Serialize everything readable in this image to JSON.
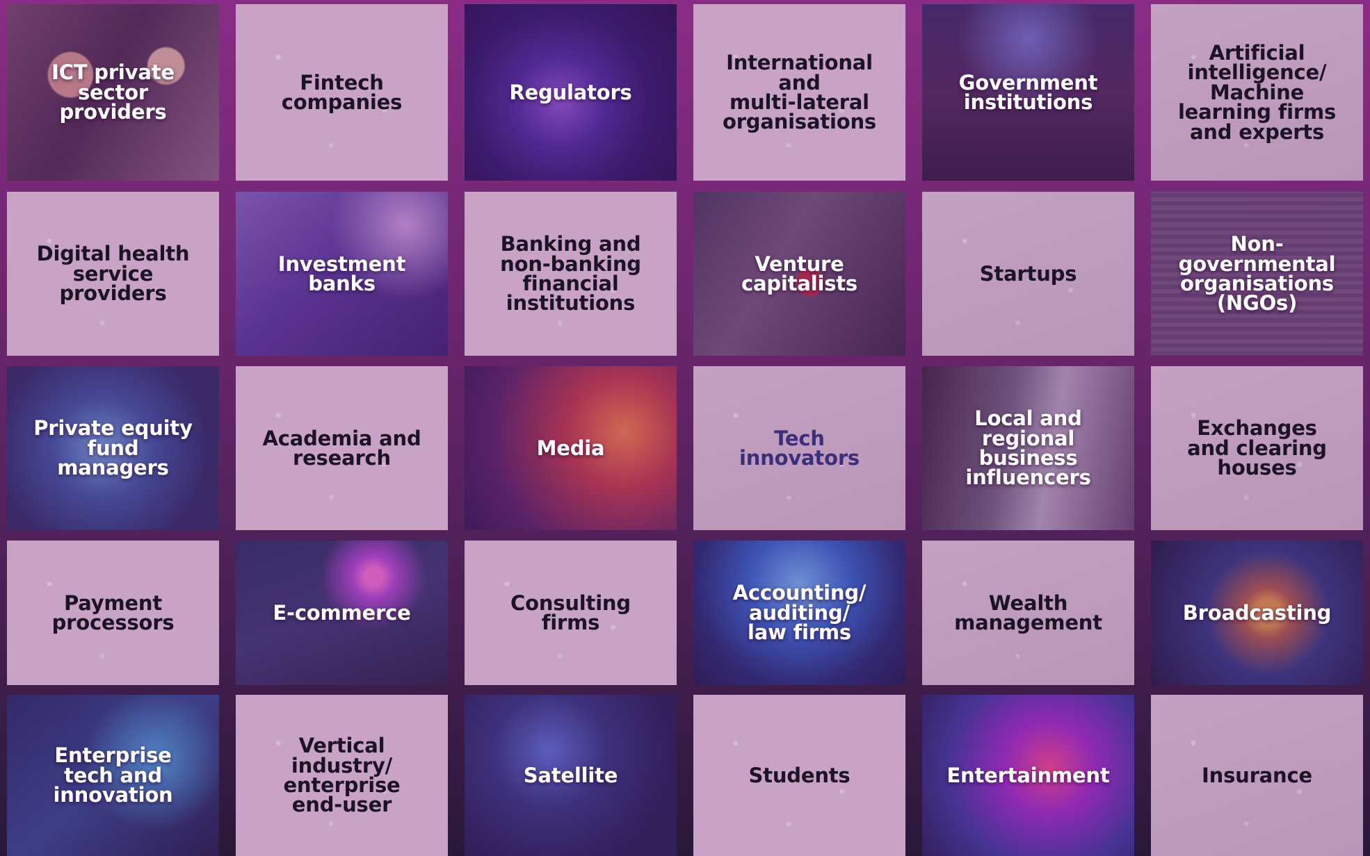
{
  "tiles": [
    {
      "label": "ICT private\nsector\nproviders",
      "style": "photo",
      "bg": "bg-expo"
    },
    {
      "label": "Fintech\ncompanies",
      "style": "plain"
    },
    {
      "label": "Regulators",
      "style": "photo",
      "bg": "bg-globe"
    },
    {
      "label": "International\nand\nmulti-lateral\norganisations",
      "style": "plain"
    },
    {
      "label": "Government\ninstitutions",
      "style": "photo",
      "bg": "bg-crowd"
    },
    {
      "label": "Artificial\nintelligence/\nMachine\nlearning firms\nand experts",
      "style": "plain dim"
    },
    {
      "label": "Digital health\nservice\nproviders",
      "style": "plain"
    },
    {
      "label": "Investment\nbanks",
      "style": "photo",
      "bg": "bg-keys"
    },
    {
      "label": "Banking and\nnon-banking\nfinancial\ninstitutions",
      "style": "plain"
    },
    {
      "label": "Venture\ncapitalists",
      "style": "photo",
      "bg": "bg-meet"
    },
    {
      "label": "Startups",
      "style": "plain dim"
    },
    {
      "label": "Non-\ngovernmental\norganisations\n(NGOs)",
      "style": "photo",
      "bg": "bg-hall"
    },
    {
      "label": "Private equity\nfund\nmanagers",
      "style": "photo",
      "bg": "bg-ai"
    },
    {
      "label": "Academia and\nresearch",
      "style": "plain"
    },
    {
      "label": "Media",
      "style": "photo",
      "bg": "bg-media"
    },
    {
      "label": "Tech\ninnovators",
      "style": "plain dim tech-label"
    },
    {
      "label": "Local and\nregional\nbusiness\ninfluencers",
      "style": "photo",
      "bg": "bg-people"
    },
    {
      "label": "Exchanges\nand clearing\nhouses",
      "style": "plain dim"
    },
    {
      "label": "Payment\nprocessors",
      "style": "plain"
    },
    {
      "label": "E-commerce",
      "style": "photo",
      "bg": "bg-robot"
    },
    {
      "label": "Consulting\nfirms",
      "style": "plain"
    },
    {
      "label": "Accounting/\nauditing/\nlaw firms",
      "style": "photo",
      "bg": "bg-hand"
    },
    {
      "label": "Wealth\nmanagement",
      "style": "plain dim"
    },
    {
      "label": "Broadcasting",
      "style": "photo",
      "bg": "bg-earth"
    },
    {
      "label": "Enterprise\ntech and\ninnovation",
      "style": "photo",
      "bg": "bg-circuit"
    },
    {
      "label": "Vertical\nindustry/\nenterprise\nend-user",
      "style": "plain"
    },
    {
      "label": "Satellite",
      "style": "photo",
      "bg": "bg-sat"
    },
    {
      "label": "Students",
      "style": "plain"
    },
    {
      "label": "Entertainment",
      "style": "photo",
      "bg": "bg-ent"
    },
    {
      "label": "Insurance",
      "style": "plain dim"
    }
  ]
}
